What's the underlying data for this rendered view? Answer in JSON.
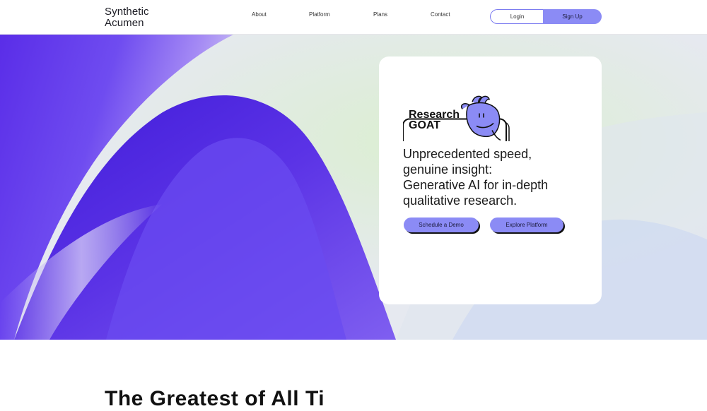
{
  "brand": {
    "line1": "Synthetic",
    "line2": "Acumen"
  },
  "nav": {
    "about": "About",
    "platform": "Platform",
    "plans": "Plans",
    "contact": "Contact",
    "login": "Login",
    "signup": "Sign Up"
  },
  "hero": {
    "badge_line1": "Research",
    "badge_line2": "GOAT",
    "headline": [
      "Unprecedented speed,",
      "genuine insight:",
      "Generative AI for in-depth",
      "qualitative research."
    ],
    "cta_demo": "Schedule a Demo",
    "cta_explore": "Explore Platform"
  },
  "section": {
    "title": "The Greatest of All Ti"
  },
  "colors": {
    "accent": "#8b8bf5",
    "deep_purple": "#4a22e0"
  },
  "icons": [
    "goat-mascot-icon"
  ]
}
